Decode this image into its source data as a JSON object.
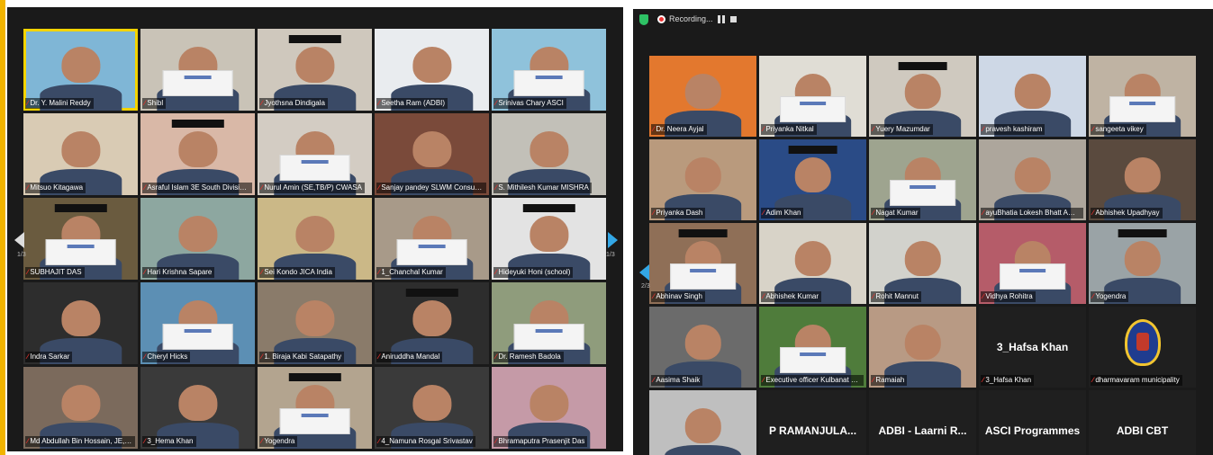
{
  "left_grid": {
    "page_indicator": "1/3",
    "page_indicator_right": "1/3",
    "participants": [
      {
        "name": "Dr. Y. Malini Reddy",
        "highlight": true,
        "bg": "#7fb6d6"
      },
      {
        "name": "Shibl",
        "bg": "#c9c3b7"
      },
      {
        "name": "Jyothsna Dindigala",
        "bg": "#cfc8bd"
      },
      {
        "name": "Seetha Ram (ADBI)",
        "bg": "#e9ecef"
      },
      {
        "name": "Srinivas Chary ASCI",
        "bg": "#8fc2db"
      },
      {
        "name": "Mitsuo Kitagawa",
        "bg": "#d9cbb4"
      },
      {
        "name": "Asraful Islam 3E South Division, SBS...",
        "bg": "#d9b8a7"
      },
      {
        "name": "Nurul Amin (SE,TB/P) CWASA",
        "bg": "#d3ccc3"
      },
      {
        "name": "Sanjay pandey SLWM Consultant...",
        "bg": "#7a4a3a"
      },
      {
        "name": "S. Mithilesh Kumar MISHRA",
        "bg": "#c2c0b8"
      },
      {
        "name": "SUBHAJIT DAS",
        "bg": "#6a5b3f"
      },
      {
        "name": "Hari Krishna Sapare",
        "bg": "#8da7a0"
      },
      {
        "name": "Sei Kondo JICA India",
        "bg": "#cbb887"
      },
      {
        "name": "1_Chanchal Kumar",
        "bg": "#a89a89"
      },
      {
        "name": "Hideyuki Honi (school)",
        "bg": "#e3e3e3"
      },
      {
        "name": "Indra Sarkar",
        "bg": "#2d2d2d"
      },
      {
        "name": "Cheryl Hicks",
        "bg": "#5c8fb4"
      },
      {
        "name": "1. Biraja Kabi Satapathy",
        "bg": "#8a7b6a"
      },
      {
        "name": "Aniruddha Mandal",
        "bg": "#2d2d2d"
      },
      {
        "name": "Dr. Ramesh Badola",
        "bg": "#8f9c7c"
      },
      {
        "name": "Md Abdullah Bin Hossain, JE, JICA...",
        "bg": "#7b6a5c"
      },
      {
        "name": "3_Hema Khan",
        "bg": "#3a3a3a"
      },
      {
        "name": "Yogendra",
        "bg": "#b3a48f"
      },
      {
        "name": "4_Namuna Rosgal Srivastav",
        "bg": "#3a3a3a"
      },
      {
        "name": "Bhramaputra Prasenjit Das",
        "bg": "#c59aa7"
      }
    ]
  },
  "right_grid": {
    "toolbar": {
      "recording_label": "Recording..."
    },
    "page_indicator": "2/3",
    "participants": [
      {
        "name": "Dr. Neera Ayjal",
        "bg": "#e3782e"
      },
      {
        "name": "Priyanka Nitkal",
        "bg": "#e0ddd5"
      },
      {
        "name": "Yuery Mazumdar",
        "bg": "#cfc9bf"
      },
      {
        "name": "pravesh kashiram",
        "bg": "#ced8e6"
      },
      {
        "name": "sangeeta vikey",
        "bg": "#bfb3a3"
      },
      {
        "name": "Priyanka Dash",
        "bg": "#b99a7d"
      },
      {
        "name": "Adim Khan",
        "bg": "#2a4b86"
      },
      {
        "name": "Nagat Kumar",
        "bg": "#9ea48f"
      },
      {
        "name": "ayuBhatia Lokesh Bhatt AmMotopur...",
        "bg": "#ada69c"
      },
      {
        "name": "Abhishek Upadhyay",
        "bg": "#5a4a3e"
      },
      {
        "name": "Abhinav Singh",
        "bg": "#8f6f57"
      },
      {
        "name": "Abhishek Kumar",
        "bg": "#d8d3c8"
      },
      {
        "name": "Rohit Mannut",
        "bg": "#d2d2cc"
      },
      {
        "name": "Vidhya Rohitra",
        "bg": "#b55c69"
      },
      {
        "name": "Yogendra",
        "bg": "#9aa3a6"
      },
      {
        "name": "Aasima Shaik",
        "bg": "#6b6b6b"
      },
      {
        "name": "Executive officer Kulbanat singh Y...",
        "bg": "#4f7c3b"
      },
      {
        "name": "Ramaiah",
        "bg": "#b89a84"
      },
      {
        "name": "3_Hafsa Khan",
        "bg": "#1f1f1f",
        "text": "3_Hafsa Khan"
      },
      {
        "name": "dharmavaram municipality",
        "bg": "#1f1f1f",
        "emblem": true
      },
      {
        "name": "",
        "bg": "#bfbfbf"
      },
      {
        "name": "",
        "bg": "#1f1f1f",
        "text": "P RAMANJULA..."
      },
      {
        "name": "",
        "bg": "#1f1f1f",
        "text": "ADBI - Laarni R..."
      },
      {
        "name": "",
        "bg": "#1f1f1f",
        "text": "ASCI Programmes"
      },
      {
        "name": "",
        "bg": "#1f1f1f",
        "text": "ADBI CBT"
      }
    ]
  }
}
